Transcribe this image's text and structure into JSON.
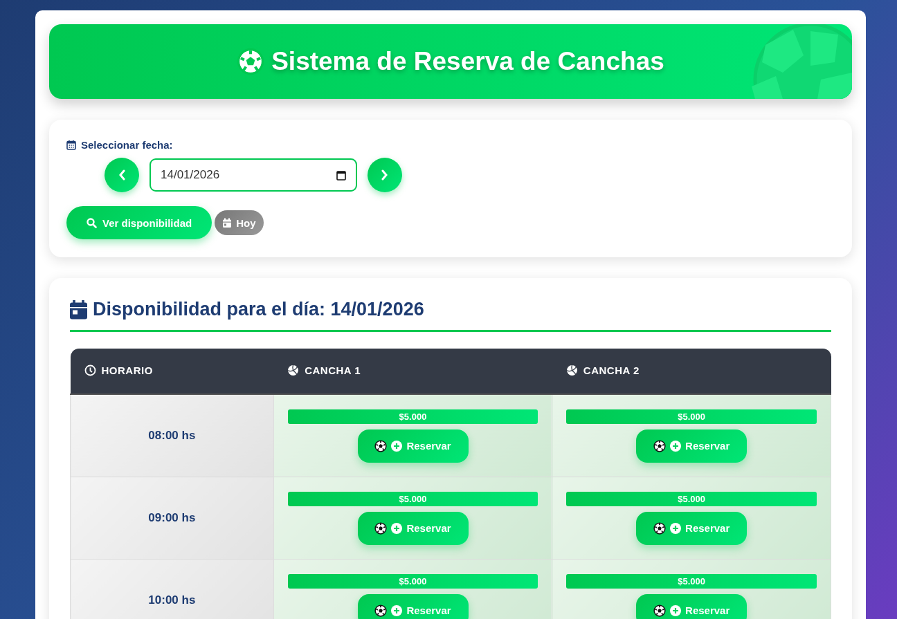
{
  "header": {
    "title": "Sistema de Reserva de Canchas"
  },
  "date_picker": {
    "label": "Seleccionar fecha:",
    "value": "14/01/2026",
    "search_button": "Ver disponibilidad",
    "today_button": "Hoy"
  },
  "availability": {
    "title": "Disponibilidad para el día: 14/01/2026",
    "columns": [
      "HORARIO",
      "CANCHA 1",
      "CANCHA 2"
    ],
    "rows": [
      {
        "time": "08:00 hs",
        "slots": [
          {
            "price": "$5.000",
            "action": "Reservar"
          },
          {
            "price": "$5.000",
            "action": "Reservar"
          }
        ]
      },
      {
        "time": "09:00 hs",
        "slots": [
          {
            "price": "$5.000",
            "action": "Reservar"
          },
          {
            "price": "$5.000",
            "action": "Reservar"
          }
        ]
      },
      {
        "time": "10:00 hs",
        "slots": [
          {
            "price": "$5.000",
            "action": "Reservar"
          },
          {
            "price": "$5.000",
            "action": "Reservar"
          }
        ]
      }
    ]
  }
}
